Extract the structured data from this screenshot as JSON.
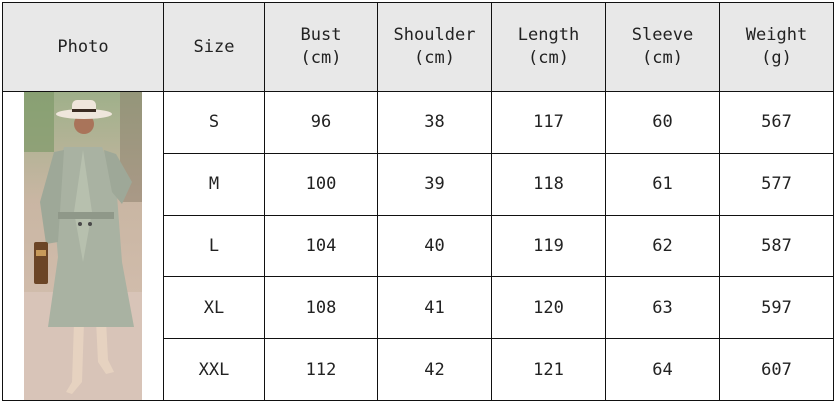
{
  "table": {
    "headers": [
      {
        "label": "Photo",
        "unit": ""
      },
      {
        "label": "Size",
        "unit": ""
      },
      {
        "label": "Bust",
        "unit": "(cm)"
      },
      {
        "label": "Shoulder",
        "unit": "(cm)"
      },
      {
        "label": "Length",
        "unit": "(cm)"
      },
      {
        "label": "Sleeve",
        "unit": "(cm)"
      },
      {
        "label": "Weight",
        "unit": "(g)"
      }
    ],
    "rows": [
      {
        "size": "S",
        "bust": "96",
        "shoulder": "38",
        "length": "117",
        "sleeve": "60",
        "weight": "567"
      },
      {
        "size": "M",
        "bust": "100",
        "shoulder": "39",
        "length": "118",
        "sleeve": "61",
        "weight": "577"
      },
      {
        "size": "L",
        "bust": "104",
        "shoulder": "40",
        "length": "119",
        "sleeve": "62",
        "weight": "587"
      },
      {
        "size": "XL",
        "bust": "108",
        "shoulder": "41",
        "length": "120",
        "sleeve": "63",
        "weight": "597"
      },
      {
        "size": "XXL",
        "bust": "112",
        "shoulder": "42",
        "length": "121",
        "sleeve": "64",
        "weight": "607"
      }
    ]
  },
  "colors": {
    "header_bg": "#e8e8e8",
    "border": "#111111",
    "coat": "#a9b2a2"
  }
}
